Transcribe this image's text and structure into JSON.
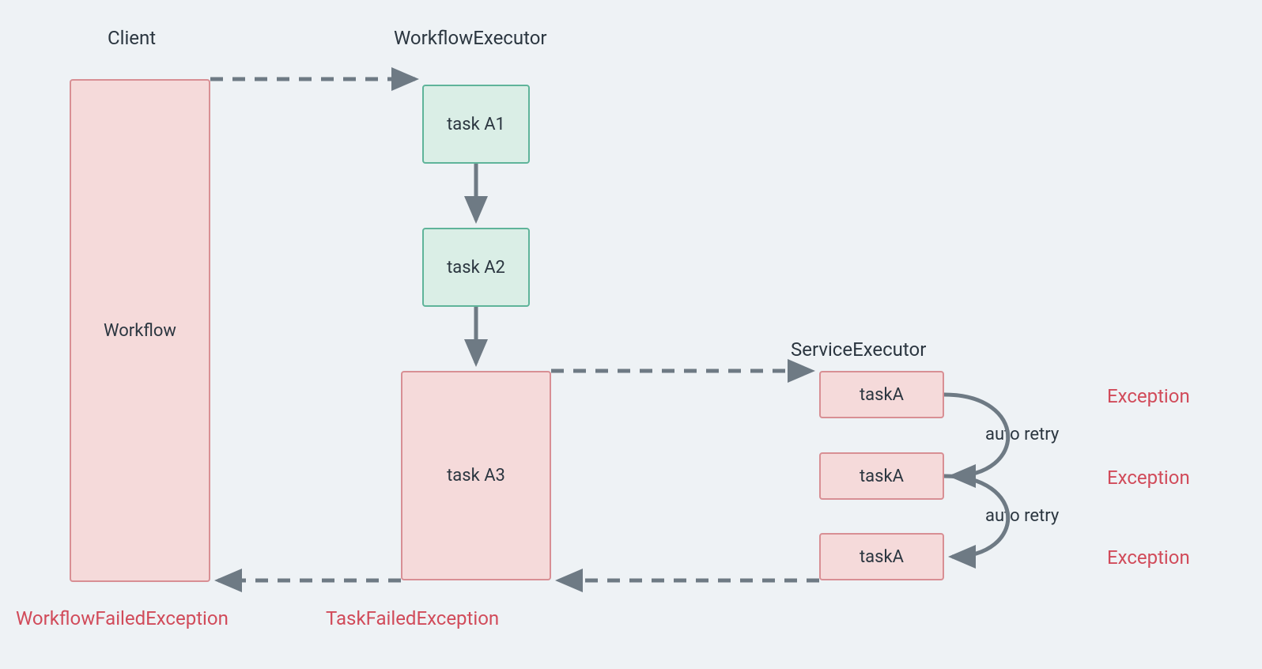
{
  "headers": {
    "client": "Client",
    "workflowExecutor": "WorkflowExecutor",
    "serviceExecutor": "ServiceExecutor"
  },
  "boxes": {
    "workflow": "Workflow",
    "taskA1": "task A1",
    "taskA2": "task A2",
    "taskA3": "task A3",
    "taskA_r1": "taskA",
    "taskA_r2": "taskA",
    "taskA_r3": "taskA"
  },
  "errors": {
    "workflowFailed": "WorkflowFailedException",
    "taskFailed": "TaskFailedException",
    "exception1": "Exception",
    "exception2": "Exception",
    "exception3": "Exception"
  },
  "retry": {
    "label1": "auto retry",
    "label2": "auto retry"
  },
  "colors": {
    "redBorder": "#d88f94",
    "redFill": "#f5dada",
    "greenBorder": "#5fb49a",
    "greenFill": "#daeee6",
    "arrow": "#6e7a84",
    "text": "#2b3640",
    "errorText": "#d14b5a",
    "bg": "#eef2f5"
  }
}
